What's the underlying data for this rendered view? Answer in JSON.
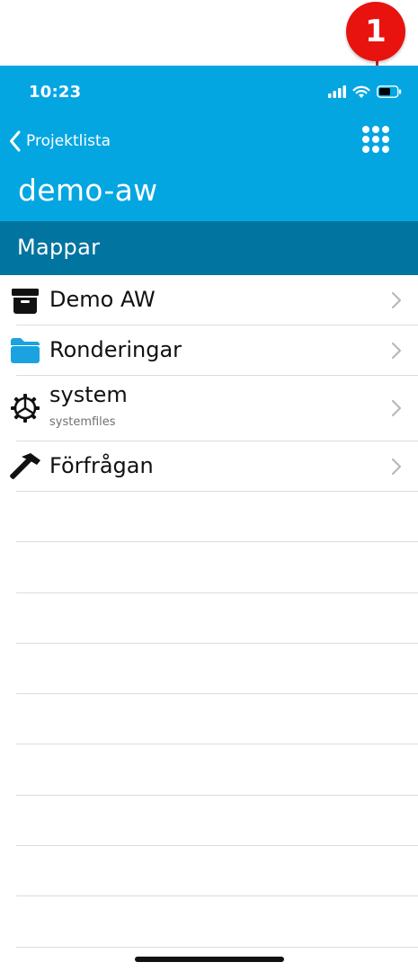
{
  "annotation": {
    "number": "1"
  },
  "status_bar": {
    "time": "10:23"
  },
  "header": {
    "back_label": "Projektlista",
    "title": "demo-aw"
  },
  "section": {
    "title": "Mappar"
  },
  "list": {
    "items": [
      {
        "label": "Demo AW",
        "icon": "archive-box-icon"
      },
      {
        "label": "Ronderingar",
        "icon": "folder-icon"
      },
      {
        "label": "system",
        "sublabel": "systemfiles",
        "icon": "gear-icon"
      },
      {
        "label": "Förfrågan",
        "icon": "hammer-icon"
      }
    ]
  },
  "colors": {
    "header": "#04a6e2",
    "section": "#0274a0",
    "folder": "#1aa3e0",
    "callout": "#e8120f"
  }
}
